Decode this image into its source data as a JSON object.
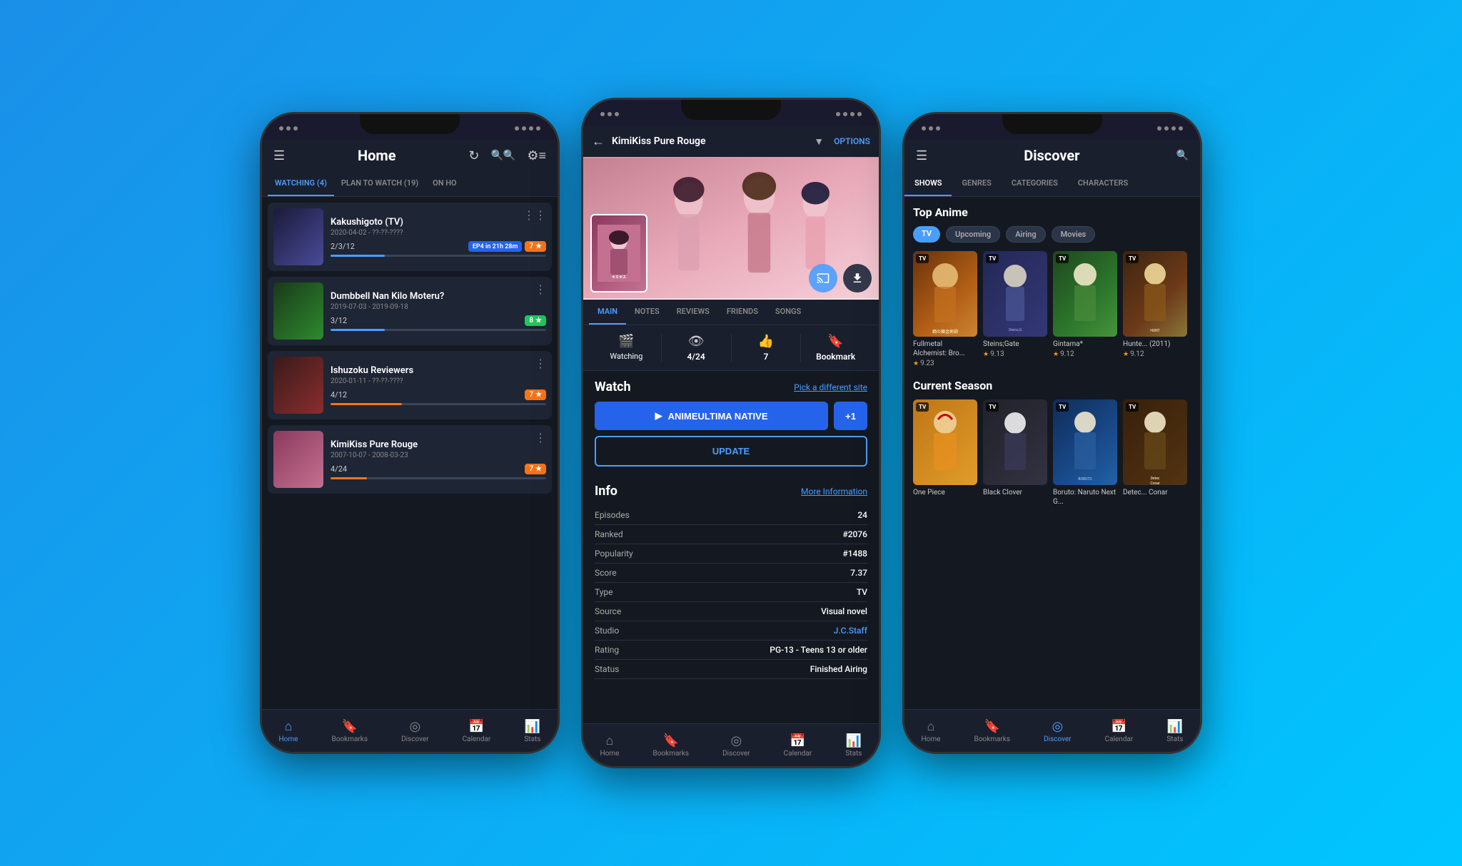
{
  "phone1": {
    "title": "Home",
    "tabs": [
      {
        "label": "WATCHING (4)",
        "active": true
      },
      {
        "label": "PLAN TO WATCH (19)",
        "active": false
      },
      {
        "label": "ON HO",
        "active": false
      }
    ],
    "shows": [
      {
        "title": "Kakushigoto (TV)",
        "date": "2020-04-02 - ??-??-????",
        "progress": "2/3/12",
        "badge_ep": "EP4 in 21h 28m",
        "badge_score": "7",
        "badge_type": "orange",
        "progress_pct": 25
      },
      {
        "title": "Dumbbell Nan Kilo Moteru?",
        "date": "2019-07-03 - 2019-09-18",
        "progress": "3/12",
        "badge_score": "8",
        "badge_type": "green",
        "progress_pct": 25
      },
      {
        "title": "Ishuzoku Reviewers",
        "date": "2020-01-11 - ??-??-????",
        "progress": "4/12",
        "badge_score": "7",
        "badge_type": "orange",
        "progress_pct": 33
      },
      {
        "title": "KimiKiss Pure Rouge",
        "date": "2007-10-07 - 2008-03-23",
        "progress": "4/24",
        "badge_score": "7",
        "badge_type": "orange",
        "progress_pct": 17
      }
    ],
    "nav": [
      {
        "label": "Home",
        "active": true
      },
      {
        "label": "Bookmarks",
        "active": false
      },
      {
        "label": "Discover",
        "active": false
      },
      {
        "label": "Calendar",
        "active": false
      },
      {
        "label": "Stats",
        "active": false
      }
    ]
  },
  "phone2": {
    "title": "KimiKiss Pure Rouge",
    "options_label": "OPTIONS",
    "tabs": [
      "MAIN",
      "NOTES",
      "REVIEWS",
      "FRIENDS",
      "SONGS"
    ],
    "stats": [
      {
        "icon": "film",
        "label": "Watching",
        "value": ""
      },
      {
        "icon": "eye",
        "label": "4/24",
        "value": ""
      },
      {
        "icon": "thumb_up",
        "label": "7",
        "value": ""
      },
      {
        "icon": "bookmark",
        "label": "Bookmark",
        "value": ""
      }
    ],
    "watch_title": "Watch",
    "pick_site_label": "Pick a different site",
    "watch_btn_label": "ANIMEULTIMA NATIVE",
    "watch_btn_plus": "+1",
    "update_btn_label": "UPDATE",
    "info_title": "Info",
    "more_info_label": "More Information",
    "info_rows": [
      {
        "label": "Episodes",
        "value": "24"
      },
      {
        "label": "Ranked",
        "value": "#2076"
      },
      {
        "label": "Popularity",
        "value": "#1488"
      },
      {
        "label": "Score",
        "value": "7.37"
      },
      {
        "label": "Type",
        "value": "TV"
      },
      {
        "label": "Source",
        "value": "Visual novel"
      },
      {
        "label": "Studio",
        "value": "J.C.Staff",
        "is_link": true
      },
      {
        "label": "Rating",
        "value": "PG-13 - Teens 13 or older"
      },
      {
        "label": "Status",
        "value": "Finished Airing"
      }
    ]
  },
  "phone3": {
    "title": "Discover",
    "tabs": [
      "SHOWS",
      "GENRES",
      "CATEGORIES",
      "CHARACTERS"
    ],
    "top_anime_title": "Top Anime",
    "filter_pills": [
      "TV",
      "Upcoming",
      "Airing",
      "Movies"
    ],
    "top_anime": [
      {
        "name": "Fullmetal Alchemist: Bro...",
        "score": "9.23",
        "type": "TV",
        "color": "fma"
      },
      {
        "name": "Steins;Gate",
        "score": "9.13",
        "type": "TV",
        "color": "steins"
      },
      {
        "name": "Gintama*",
        "score": "9.12",
        "type": "TV",
        "color": "gintama"
      },
      {
        "name": "Hunte... (2011)",
        "score": "9.12",
        "type": "TV",
        "color": "hunter"
      }
    ],
    "current_season_title": "Current Season",
    "current_season": [
      {
        "name": "One Piece",
        "type": "TV",
        "color": "onepiece"
      },
      {
        "name": "Black Clover",
        "type": "TV",
        "color": "blackclover"
      },
      {
        "name": "Boruto: Naruto Next G...",
        "type": "TV",
        "color": "boruto"
      },
      {
        "name": "Detec... Conar",
        "type": "TV",
        "color": "detective"
      }
    ],
    "nav": [
      {
        "label": "Home",
        "active": false
      },
      {
        "label": "Bookmarks",
        "active": false
      },
      {
        "label": "Discover",
        "active": true
      },
      {
        "label": "Calendar",
        "active": false
      },
      {
        "label": "Stats",
        "active": false
      }
    ]
  }
}
